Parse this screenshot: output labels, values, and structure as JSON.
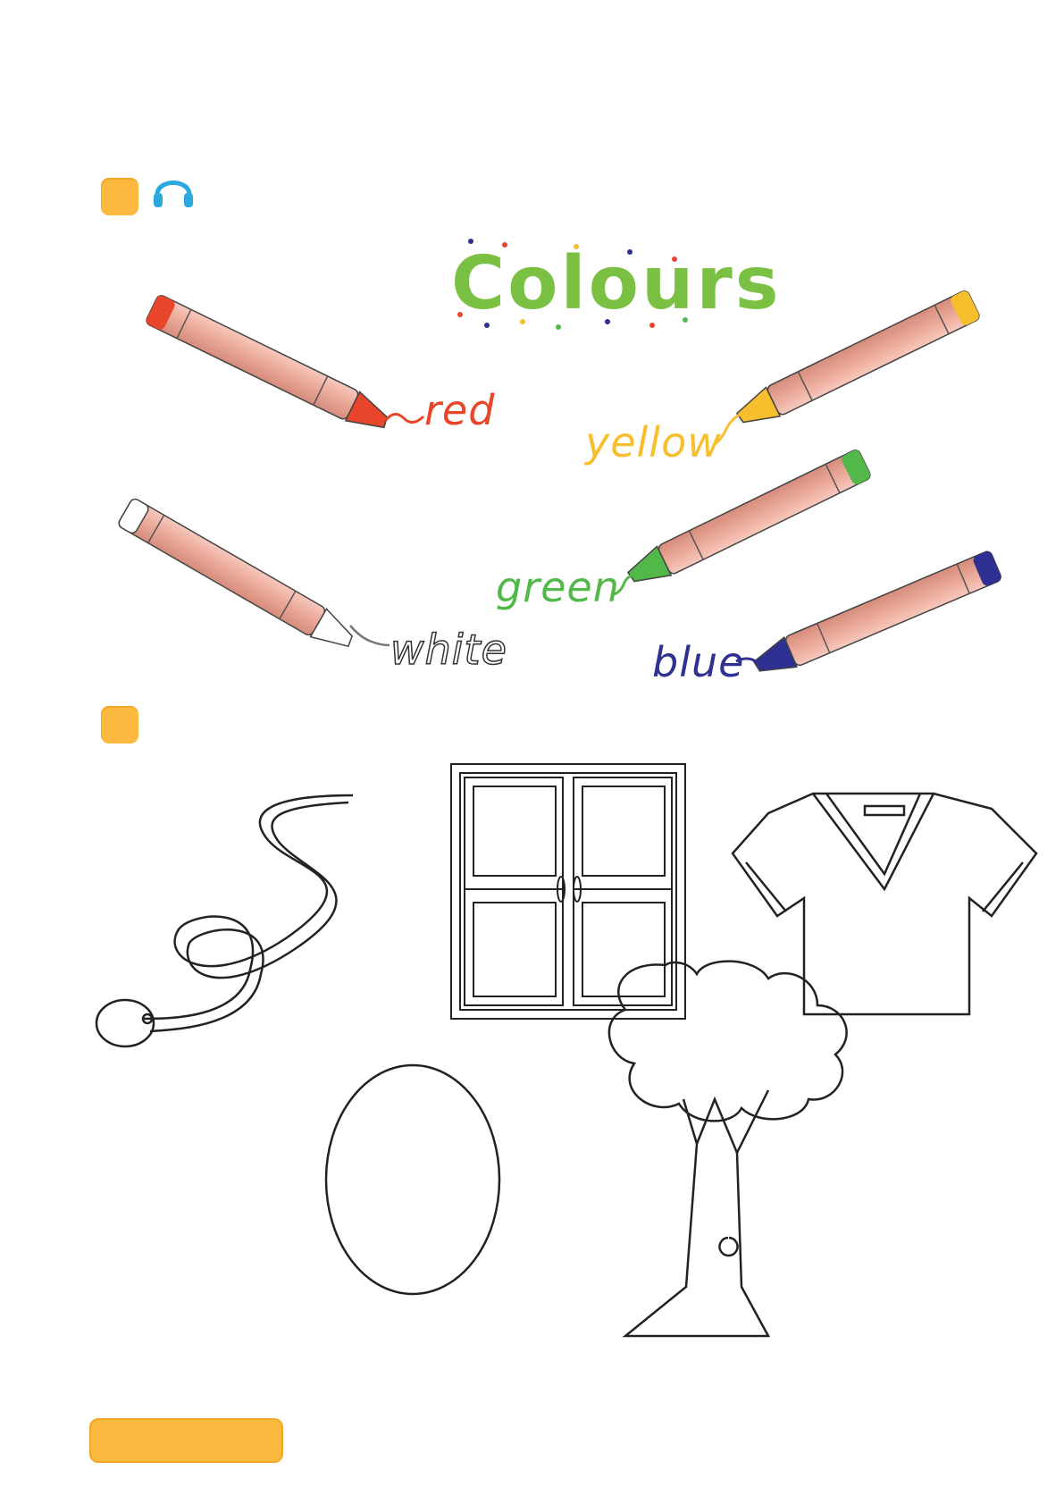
{
  "title": "Colours",
  "colours": [
    {
      "label": "red",
      "color": "#e8452a"
    },
    {
      "label": "yellow",
      "color": "#f7bf2e"
    },
    {
      "label": "white",
      "color": "#ffffff"
    },
    {
      "label": "green",
      "color": "#52b849"
    },
    {
      "label": "blue",
      "color": "#2e3192"
    }
  ],
  "icons": {
    "audio": "headphones-icon"
  },
  "theme": {
    "badge": "#fcb940",
    "title_green": "#7ac143"
  }
}
